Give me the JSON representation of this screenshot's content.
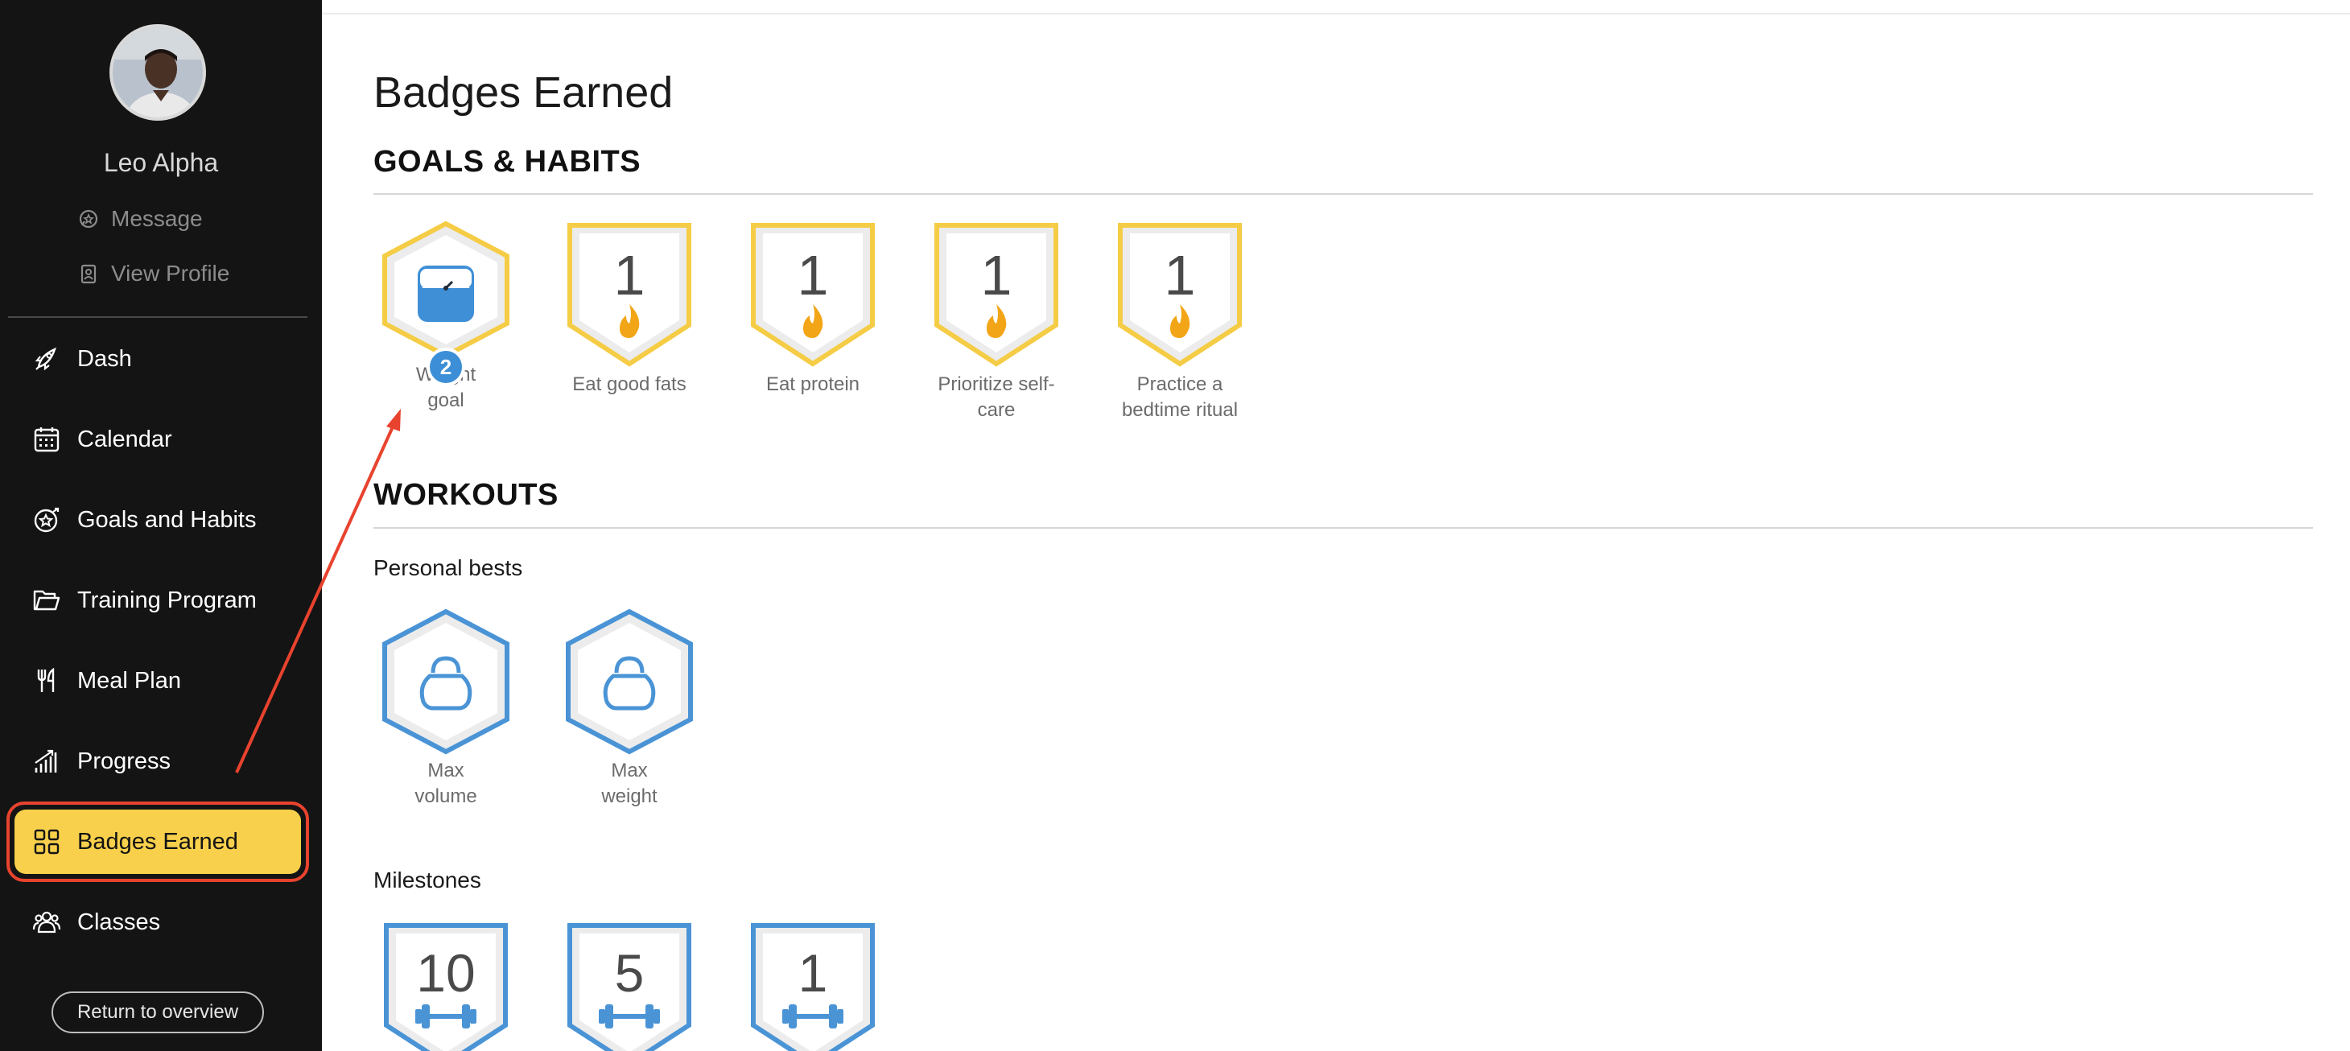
{
  "sidebar": {
    "user_name": "Leo Alpha",
    "links": [
      {
        "label": "Message",
        "icon": "chat-icon"
      },
      {
        "label": "View Profile",
        "icon": "profile-card-icon"
      }
    ],
    "nav": [
      {
        "label": "Dash",
        "icon": "rocket-icon"
      },
      {
        "label": "Calendar",
        "icon": "calendar-icon"
      },
      {
        "label": "Goals and Habits",
        "icon": "star-target-icon"
      },
      {
        "label": "Training Program",
        "icon": "folder-icon"
      },
      {
        "label": "Meal Plan",
        "icon": "fork-knife-icon"
      },
      {
        "label": "Progress",
        "icon": "bar-chart-icon"
      },
      {
        "label": "Badges Earned",
        "icon": "grid-icon",
        "active": true
      },
      {
        "label": "Classes",
        "icon": "group-icon"
      }
    ],
    "return_label": "Return to overview",
    "active_color": "#f8d04b",
    "highlight_color": "#e8432e"
  },
  "main": {
    "title": "Badges Earned",
    "goals_section": {
      "title": "GOALS & HABITS",
      "badges": [
        {
          "label_lines": [
            "Weight",
            "goal"
          ],
          "icon": "scale-icon",
          "count": "2"
        },
        {
          "label_lines": [
            "Eat good fats"
          ],
          "number": "1",
          "icon": "flame-icon"
        },
        {
          "label_lines": [
            "Eat protein"
          ],
          "number": "1",
          "icon": "flame-icon"
        },
        {
          "label_lines": [
            "Prioritize self-",
            "care"
          ],
          "number": "1",
          "icon": "flame-icon"
        },
        {
          "label_lines": [
            "Practice a",
            "bedtime ritual"
          ],
          "number": "1",
          "icon": "flame-icon"
        }
      ]
    },
    "workouts_section": {
      "title": "WORKOUTS",
      "personal_bests_title": "Personal bests",
      "personal_bests": [
        {
          "label_lines": [
            "Max",
            "volume"
          ],
          "icon": "kettlebell-icon"
        },
        {
          "label_lines": [
            "Max",
            "weight"
          ],
          "icon": "kettlebell-icon"
        }
      ],
      "milestones_title": "Milestones",
      "milestones": [
        {
          "number": "10",
          "icon": "dumbbell-icon"
        },
        {
          "number": "5",
          "icon": "dumbbell-icon"
        },
        {
          "number": "1",
          "icon": "dumbbell-icon"
        }
      ]
    },
    "colors": {
      "gold": "#f5cc45",
      "blue": "#4a94d6",
      "flame": "#f2a516"
    }
  }
}
